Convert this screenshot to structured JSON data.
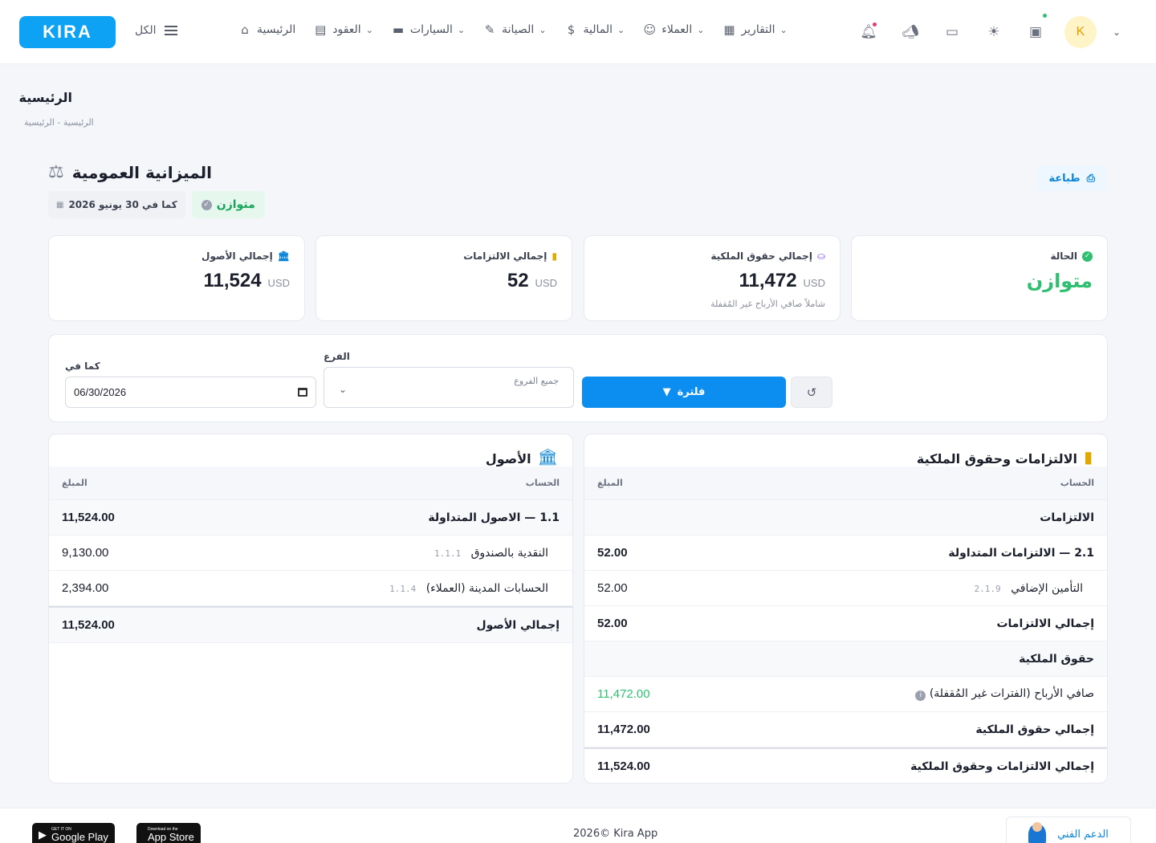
{
  "header": {
    "logo_text": "KIRA",
    "all_label": "الكل",
    "nav": [
      {
        "label": "الرئيسية",
        "icon": "home-icon",
        "has_menu": false
      },
      {
        "label": "العقود",
        "icon": "document-icon",
        "has_menu": true
      },
      {
        "label": "السيارات",
        "icon": "car-icon",
        "has_menu": true
      },
      {
        "label": "الصيانة",
        "icon": "wrench-icon",
        "has_menu": true
      },
      {
        "label": "المالية",
        "icon": "dollar-icon",
        "has_menu": true
      },
      {
        "label": "العملاء",
        "icon": "users-icon",
        "has_menu": true
      },
      {
        "label": "التقارير",
        "icon": "report-icon",
        "has_menu": true
      }
    ],
    "avatar_initial": "K"
  },
  "page": {
    "title": "الرئيسية",
    "breadcrumb": "الرئيسية - الرئيسية"
  },
  "balance_sheet": {
    "title": "الميزانية العمومية",
    "print_label": "طباعة",
    "status_badge": "متوازن",
    "as_of_label": "كما في 30 يونيو 2026"
  },
  "stats": {
    "assets": {
      "label": "إجمالي الأصول",
      "value": "11,524",
      "currency": "USD"
    },
    "liabilities": {
      "label": "إجمالي الالتزامات",
      "value": "52",
      "currency": "USD"
    },
    "equity": {
      "label": "إجمالي حقوق الملكية",
      "value": "11,472",
      "currency": "USD",
      "note": "شاملاً صافي الأرباح غير المُقفلة"
    },
    "status": {
      "label": "الحالة",
      "value": "متوازن"
    }
  },
  "filters": {
    "as_of_label": "كما في",
    "as_of_value": "06/30/2026",
    "branch_label": "الفرع",
    "branch_placeholder": "جميع الفروع",
    "filter_button": "فلترة"
  },
  "assets_panel": {
    "title": "الأصول",
    "col_account": "الحساب",
    "col_amount": "المبلغ",
    "rows": [
      {
        "type": "group",
        "name": "1.1 — الاصول المتداولة",
        "code": "",
        "amount": "11,524.00"
      },
      {
        "type": "sub",
        "name": "النقدية بالصندوق",
        "code": "1.1.1",
        "amount": "9,130.00"
      },
      {
        "type": "sub",
        "name": "الحسابات المدينة (العملاء)",
        "code": "1.1.4",
        "amount": "2,394.00"
      }
    ],
    "total": {
      "name": "إجمالي الأصول",
      "amount": "11,524.00"
    }
  },
  "liab_panel": {
    "title": "الالتزامات وحقوق الملكية",
    "col_account": "الحساب",
    "col_amount": "المبلغ",
    "liab_section": "الالتزامات",
    "liab_group": {
      "name": "2.1 — الالتزامات المتداولة",
      "amount": "52.00"
    },
    "liab_sub": {
      "name": "التأمين الإضافي",
      "code": "2.1.9",
      "amount": "52.00"
    },
    "liab_total": {
      "name": "إجمالي الالتزامات",
      "amount": "52.00"
    },
    "equity_section": "حقوق الملكية",
    "net_profit": {
      "name": "صافي الأرباح (الفترات غير المُقفلة)",
      "amount": "11,472.00"
    },
    "equity_total": {
      "name": "إجمالي حقوق الملكية",
      "amount": "11,472.00"
    },
    "grand_total": {
      "name": "إجمالي الالتزامات وحقوق الملكية",
      "amount": "11,524.00"
    }
  },
  "footer": {
    "google_small": "GET IT ON",
    "google_big": "Google Play",
    "apple_small": "Download on the",
    "apple_big": "App Store",
    "copyright": "2026© Kira App",
    "support": "الدعم الفني"
  },
  "colors": {
    "primary": "#0b8ef0",
    "success": "#2fbf71",
    "logo": "#0ea2f5"
  }
}
